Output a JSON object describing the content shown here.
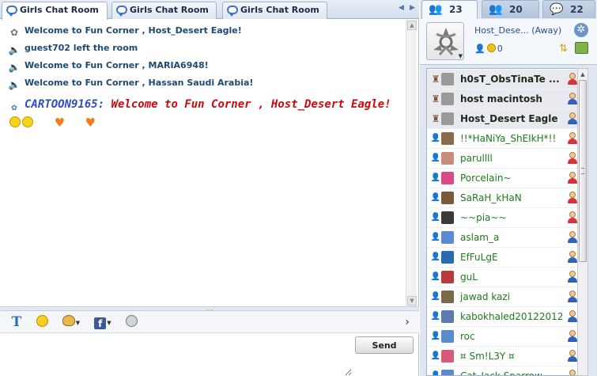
{
  "room_tabs": [
    {
      "label": "Girls Chat Room",
      "active": true
    },
    {
      "label": "Girls Chat Room",
      "active": false
    },
    {
      "label": "Girls Chat Room",
      "active": false
    }
  ],
  "messages": [
    {
      "icon": "host-icon",
      "text": "Welcome to Fun Corner , Host_Desert Eagle!"
    },
    {
      "icon": "speaker-icon",
      "text": "guest702 left the room"
    },
    {
      "icon": "speaker-icon",
      "text": "Welcome to Fun Corner , MARIA6948!"
    },
    {
      "icon": "speaker-icon",
      "text": "Welcome to Fun Corner , Hassan Saudi Arabia!"
    }
  ],
  "chat_message": {
    "username": "CARTOON9165:",
    "text": "Welcome to Fun Corner , Host_Desert Eagle!"
  },
  "composer": {
    "input_value": "",
    "send_label": "Send"
  },
  "side_tabs": [
    {
      "count": "23",
      "icon": "users-icon",
      "active": true
    },
    {
      "count": "20",
      "icon": "friends-icon",
      "active": false
    },
    {
      "count": "22",
      "icon": "chat-icon",
      "active": false
    }
  ],
  "profile": {
    "name": "Host_Dese... (Away)",
    "coins": "0"
  },
  "users": [
    {
      "name": "h0sT_ObsTinaTe ...",
      "role": "host",
      "gender": "female",
      "avatar_color": "#9a9a9a",
      "green": false
    },
    {
      "name": "host macintosh",
      "role": "host",
      "gender": "male",
      "avatar_color": "#9a9a9a",
      "green": false
    },
    {
      "name": "Host_Desert Eagle",
      "role": "host",
      "gender": "male",
      "avatar_color": "#9a9a9a",
      "green": false
    },
    {
      "name": "!!*HaNiYa_ShEIkH*!!",
      "role": "user",
      "gender": "female",
      "avatar_color": "#8a6b4a",
      "green": true
    },
    {
      "name": "parullll",
      "role": "user",
      "gender": "female",
      "avatar_color": "#c98c7a",
      "green": true
    },
    {
      "name": "Porcelain~",
      "role": "user",
      "gender": "female",
      "avatar_color": "#d84a8a",
      "green": true
    },
    {
      "name": "SaRaH_kHaN",
      "role": "user",
      "gender": "female",
      "avatar_color": "#7a5a3a",
      "green": true
    },
    {
      "name": "~~pia~~",
      "role": "user",
      "gender": "female",
      "avatar_color": "#3a3a3a",
      "green": true
    },
    {
      "name": "aslam_a",
      "role": "user",
      "gender": "male",
      "avatar_color": "#5a8ad0",
      "green": true
    },
    {
      "name": "EfFuLgE",
      "role": "user",
      "gender": "male",
      "avatar_color": "#2a6ab0",
      "green": true
    },
    {
      "name": "guL",
      "role": "user",
      "gender": "male",
      "avatar_color": "#b83a3a",
      "green": true
    },
    {
      "name": "jawad kazi",
      "role": "user",
      "gender": "male",
      "avatar_color": "#7a6a4a",
      "green": true
    },
    {
      "name": "kabokhaled20122012",
      "role": "user",
      "gender": "male",
      "avatar_color": "#5a7ab0",
      "green": true
    },
    {
      "name": "roc",
      "role": "user",
      "gender": "male",
      "avatar_color": "#5a8ad0",
      "green": true
    },
    {
      "name": "¤ Sm!L3Y ¤",
      "role": "user",
      "gender": "male",
      "avatar_color": "#d85a7a",
      "green": true
    },
    {
      "name": "Cat_Jack Sparrow",
      "role": "user",
      "gender": "male",
      "avatar_color": "#5a8ad0",
      "green": true
    }
  ],
  "colors": {
    "accent_blue": "#3b74c2",
    "chat_user": "#2e4ec4",
    "chat_text": "#d0080a",
    "system_text": "#1d4a74",
    "username_green": "#1e7a1e"
  }
}
